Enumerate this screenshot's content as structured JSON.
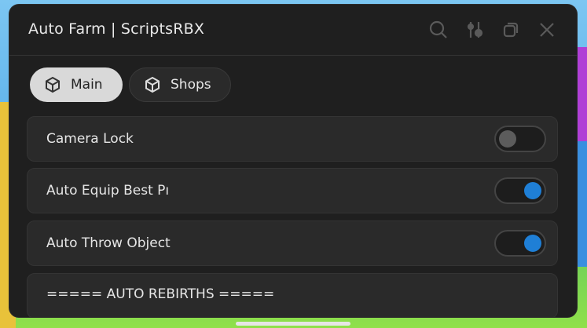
{
  "window": {
    "title": "Auto Farm | ScriptsRBX",
    "icons": [
      "search-icon",
      "sliders-icon",
      "minimize-icon",
      "close-icon"
    ]
  },
  "tabs": [
    {
      "label": "Main",
      "active": true,
      "icon": "cube-icon"
    },
    {
      "label": "Shops",
      "active": false,
      "icon": "cube-icon"
    }
  ],
  "rows": [
    {
      "label": "Camera Lock",
      "toggle": false
    },
    {
      "label": "Auto Equip Best Pı",
      "toggle": true
    },
    {
      "label": "Auto Throw Object",
      "toggle": true
    },
    {
      "label": "===== AUTO REBIRTHS ====="
    }
  ],
  "colors": {
    "window_bg": "#1f1f1f",
    "row_bg": "#2a2a2a",
    "toggle_on": "#1f7fd6",
    "tab_active_bg": "#d9d9d9"
  }
}
